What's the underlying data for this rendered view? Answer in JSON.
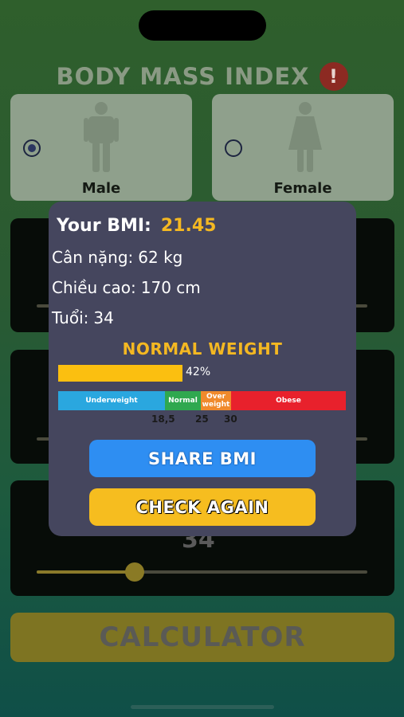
{
  "app": {
    "title": "BODY MASS INDEX",
    "info_icon": "!"
  },
  "gender": {
    "male_label": "Male",
    "female_label": "Female",
    "selected": "Male"
  },
  "background_partial_value": "34",
  "calculate_button": "CALCULATOR",
  "result": {
    "bmi_label": "Your BMI:",
    "bmi_value": "21.45",
    "weight_label": "Cân nặng:",
    "weight_value": "62 kg",
    "height_label": "Chiều cao:",
    "height_value": "170 cm",
    "age_label": "Tuổi:",
    "age_value": "34",
    "category": "NORMAL WEIGHT",
    "progress_percent": 42,
    "progress_text": "42%",
    "scale": {
      "underweight": "Underweight",
      "normal": "Normal",
      "overweight": "Over weight",
      "obese": "Obese",
      "tick_1": "18,5",
      "tick_2": "25",
      "tick_3": "30"
    },
    "share_button": "SHARE BMI",
    "check_again_button": "CHECK AGAIN"
  },
  "colors": {
    "accent_yellow": "#f4b822",
    "share_blue": "#2e8ef2",
    "modal_bg": "#45465e",
    "alert_red": "#8c2a22"
  },
  "sliders": {
    "height_level": 0.93,
    "weight_level": 0.93,
    "age_level": 0.3
  }
}
